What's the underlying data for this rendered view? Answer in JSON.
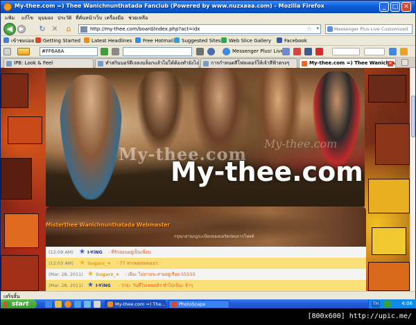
{
  "window": {
    "title": "My-thee.com =) Thee Wanichnunthatada Fanclub (Powered by www.nuzxaaa.com) - Mozilla Firefox",
    "minimize": "_",
    "maximize": "□",
    "close": "✕"
  },
  "menu": [
    "แฟ้ม",
    "แก้ไข",
    "มุมมอง",
    "ประวัติ",
    "ที่คั่นหน้าเว็บ",
    "เครื่องมือ",
    "ช่วยเหลือ"
  ],
  "nav": {
    "url": "http://my-thee.com/board/index.php?act=idx",
    "search_placeholder": "Messenger Plus Live Customized"
  },
  "bookmarks": [
    {
      "label": "เข้าชมบ่อย",
      "color": "#4a7ad8"
    },
    {
      "label": "Getting Started",
      "color": "#d8452a"
    },
    {
      "label": "Latest Headlines",
      "color": "#f08a1a"
    },
    {
      "label": "Free Hotmail",
      "color": "#3a8ad8"
    },
    {
      "label": "Suggested Sites",
      "color": "#3a9ad8"
    },
    {
      "label": "Web Slice Gallery",
      "color": "#2aa84a"
    },
    {
      "label": "Facebook",
      "color": "#3b5998"
    }
  ],
  "toolbar2": {
    "color_value": "#FF6A6A",
    "messenger_label": "Messenger Plus! Live"
  },
  "tabs": [
    {
      "label": "IPB: Look & Feel",
      "active": false
    },
    {
      "label": "ทำสกินบอร์ดีเจลงบล็อกแล้วไม่ได้ต้องทำยังไง",
      "active": false
    },
    {
      "label": "การกำหนดสีโฟลเดอร์ให้เจ้าสีฟ้าตรงๆ",
      "active": false
    },
    {
      "label": "My-thee.com =) Thee Wanichnun...",
      "active": true
    }
  ],
  "banner": {
    "ghost_text": "My-thee.com",
    "ghost_text2": "My-thee.com",
    "logo": "My-thee.com"
  },
  "board": {
    "heading": "Misterthee Wanichnunthatada Webmaster",
    "subtext": "กรุณาอ่านกฎระเบียบของบอร์ดก่อนการโพสต์"
  },
  "shoutbox": [
    {
      "time": "(12:09 AM)",
      "user": "I-YiNG",
      "user_color": "blue",
      "message": "- ที่รักออนอยู่เป็นเพื่อน",
      "row_style": "a",
      "star_color": "#3060c8"
    },
    {
      "time": "(12:03 AM)",
      "user": "Sugarz_★",
      "user_color": "gold",
      "message": "- 77 หาเพลงเพลงเยา",
      "row_style": "b",
      "star_color": "#f0b020"
    },
    {
      "time": "(Mar. 28, 2011)",
      "user": "Sugarz_★",
      "user_color": "gold",
      "message": "- เยียะ ไม่ถามจะสายอยู่เรื่อย 55555",
      "row_style": "a",
      "star_color": "#f0b020"
    },
    {
      "time": "(Mar. 28, 2011)",
      "user": "I-YiNG",
      "user_color": "blue",
      "message": "- ว่าจะ วันที่ไม่เคยแล้ว ทำไปเป้นะ ฮ้าๆ",
      "row_style": "b",
      "star_color": "#3060c8"
    }
  ],
  "status": "เสร็จสิ้น",
  "taskbar": {
    "start": "start",
    "buttons": [
      {
        "label": "My-thee.com =) The...",
        "active": true,
        "color": "#f08a1a"
      },
      {
        "label": "PhotoScape",
        "active": false,
        "color": "#d84a2a"
      }
    ],
    "lang": "TH",
    "clock": "4:06"
  },
  "watermark": "[800x600] http://upic.me/"
}
